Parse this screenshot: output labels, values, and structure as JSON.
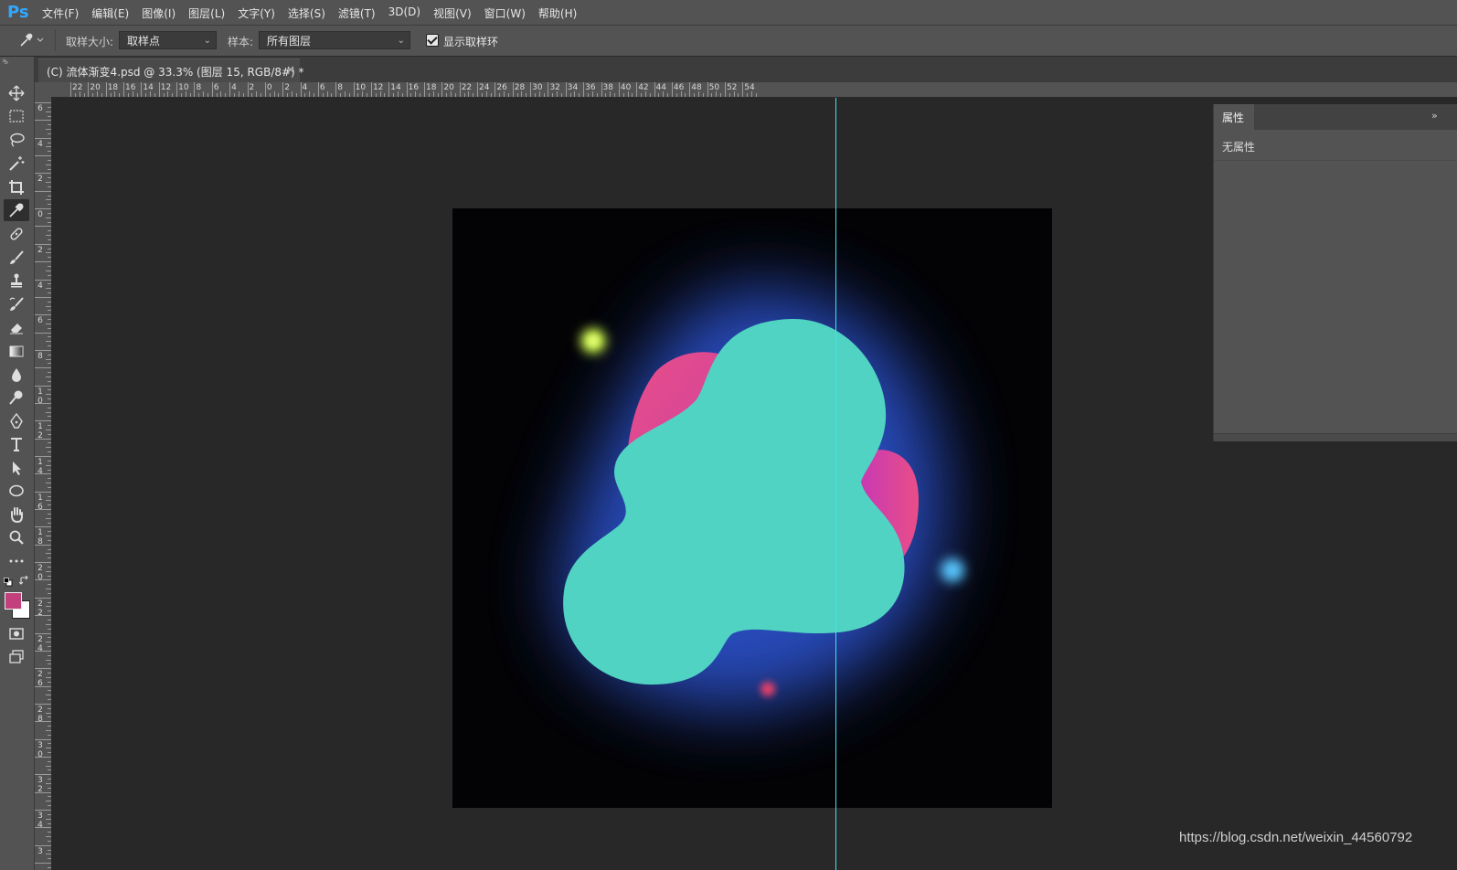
{
  "app": {
    "logo": "Ps"
  },
  "menu": {
    "items": [
      "文件(F)",
      "编辑(E)",
      "图像(I)",
      "图层(L)",
      "文字(Y)",
      "选择(S)",
      "滤镜(T)",
      "3D(D)",
      "视图(V)",
      "窗口(W)",
      "帮助(H)"
    ]
  },
  "options": {
    "sample_size_label": "取样大小:",
    "sample_size_value": "取样点",
    "sample_label": "样本:",
    "sample_value": "所有图层",
    "show_ring_label": "显示取样环",
    "show_ring_checked": true
  },
  "tab": {
    "title": "(C) 流体渐变4.psd @ 33.3% (图层 15, RGB/8#) *",
    "close": "×"
  },
  "rulers": {
    "top_labels": [
      "22",
      "20",
      "18",
      "16",
      "14",
      "12",
      "10",
      "8",
      "6",
      "4",
      "2",
      "0",
      "2",
      "4",
      "6",
      "8",
      "10",
      "12",
      "14",
      "16",
      "18",
      "20",
      "22",
      "24",
      "26",
      "28",
      "30",
      "32",
      "34",
      "36",
      "38",
      "40",
      "42",
      "44",
      "46",
      "48",
      "50",
      "52",
      "54"
    ],
    "left_labels": [
      "6",
      "4",
      "2",
      "0",
      "2",
      "4",
      "6",
      "8",
      "10",
      "12",
      "14",
      "16",
      "18",
      "20",
      "22",
      "24",
      "26",
      "28",
      "30",
      "32",
      "34",
      "3"
    ]
  },
  "properties": {
    "tab_label": "属性",
    "empty_text": "无属性"
  },
  "colors": {
    "foreground": "#c2417d",
    "background": "#ffffff",
    "guide": "#3fe3ee",
    "blob": "#50d3c2",
    "blob_pink": "#e94e88",
    "glow_blue": "#3457d6",
    "accent": "#31a8ff"
  },
  "tools": [
    "move-icon",
    "marquee-icon",
    "lasso-icon",
    "magic-wand-icon",
    "crop-icon",
    "eyedropper-icon",
    "healing-brush-icon",
    "brush-icon",
    "stamp-icon",
    "history-brush-icon",
    "eraser-icon",
    "gradient-icon",
    "blur-icon",
    "dodge-icon",
    "pen-icon",
    "type-icon",
    "path-select-icon",
    "ellipse-icon",
    "hand-icon",
    "zoom-icon",
    "more-icon"
  ],
  "watermark": "https://blog.csdn.net/weixin_44560792"
}
